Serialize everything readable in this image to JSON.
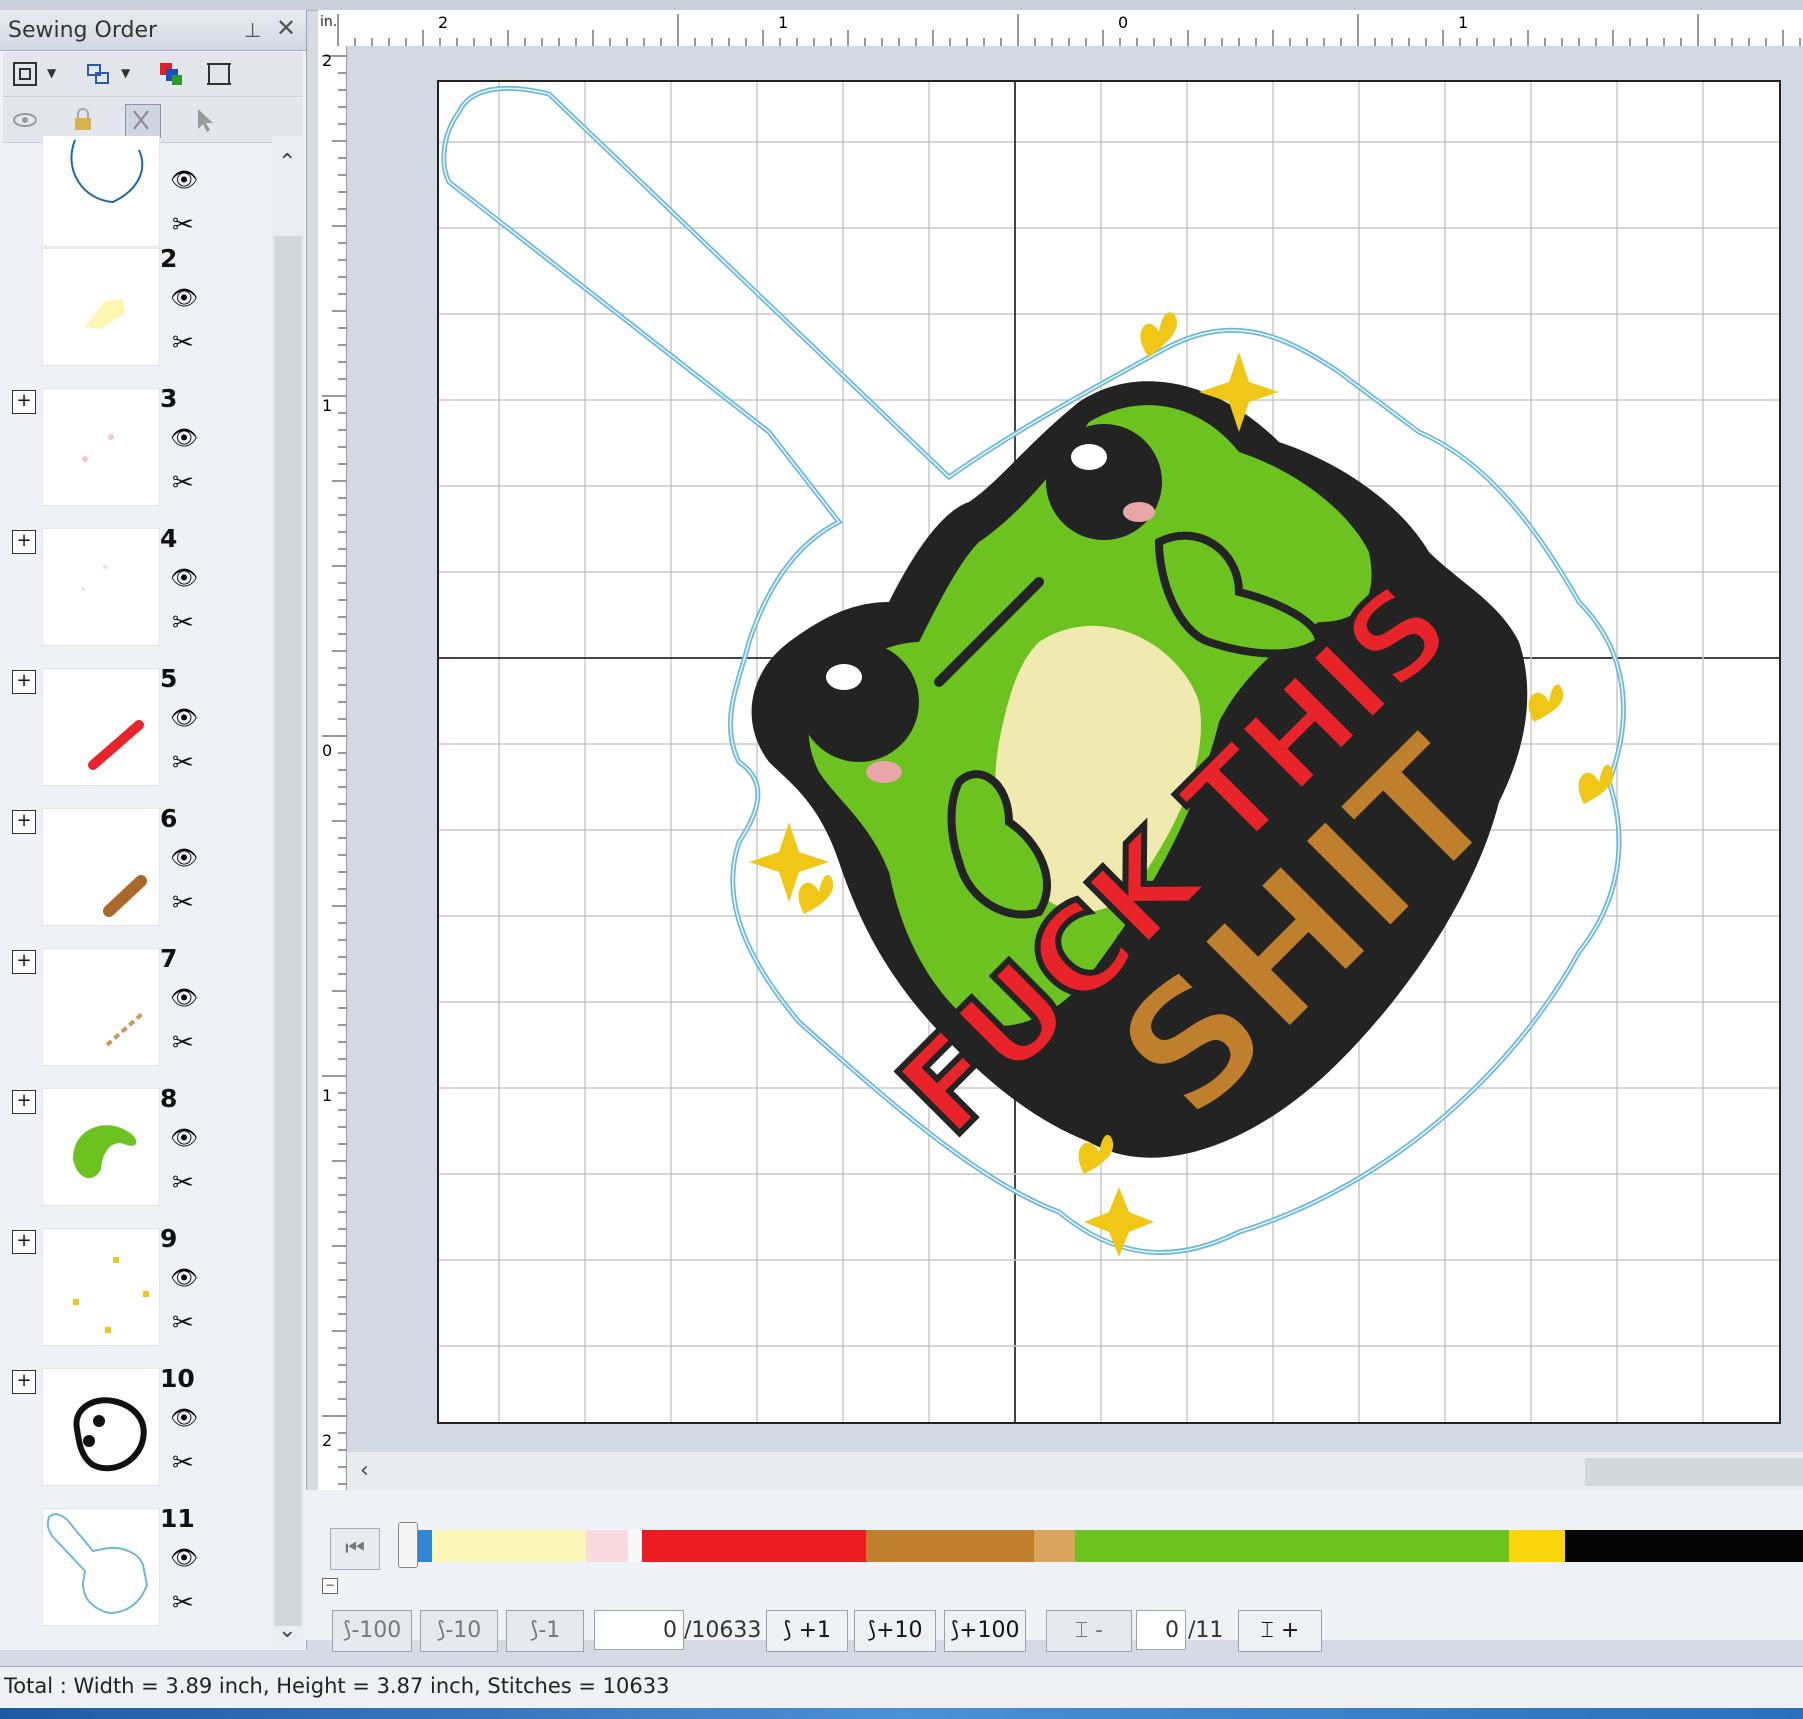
{
  "panel": {
    "title": "Sewing Order",
    "pin": "⊥",
    "close": "✕"
  },
  "sewing_items": [
    {
      "number": "",
      "has_expand": false,
      "thumb": "outline-top-icon"
    },
    {
      "number": "2",
      "has_expand": false,
      "thumb": "pale-yellow-icon"
    },
    {
      "number": "3",
      "has_expand": true,
      "thumb": "pink-dots-icon"
    },
    {
      "number": "4",
      "has_expand": true,
      "thumb": "faint-dots-icon"
    },
    {
      "number": "5",
      "has_expand": true,
      "thumb": "red-text-icon"
    },
    {
      "number": "6",
      "has_expand": true,
      "thumb": "brown-text-icon"
    },
    {
      "number": "7",
      "has_expand": true,
      "thumb": "tan-line-icon"
    },
    {
      "number": "8",
      "has_expand": true,
      "thumb": "green-frog-icon"
    },
    {
      "number": "9",
      "has_expand": true,
      "thumb": "yellow-dots-icon"
    },
    {
      "number": "10",
      "has_expand": true,
      "thumb": "black-outline-icon"
    },
    {
      "number": "11",
      "has_expand": false,
      "thumb": "blue-outline-icon"
    }
  ],
  "ruler": {
    "unit": "in.",
    "top_labels": [
      "2",
      "1",
      "0",
      "1"
    ],
    "left_labels": [
      "2",
      "1",
      "0",
      "1",
      "2"
    ]
  },
  "design_text": {
    "line1": "FUCK THIS",
    "line2": "SHIT"
  },
  "colors": {
    "frog_green": "#6cc21f",
    "belly": "#f1eab0",
    "red_text": "#e8232a",
    "brown_text": "#c07f2c",
    "yellow": "#f0c617",
    "outline_blue": "#6fb9d6",
    "black": "#232323",
    "blush": "#e9a6a9"
  },
  "color_bar": [
    {
      "color": "#2f86d6",
      "weight": 1
    },
    {
      "color": "#fbf6b9",
      "weight": 11
    },
    {
      "color": "#f9d9de",
      "weight": 3
    },
    {
      "color": "#f7f7f7",
      "weight": 1
    },
    {
      "color": "#ec1c24",
      "weight": 16
    },
    {
      "color": "#c07f2c",
      "weight": 12
    },
    {
      "color": "#d8a45e",
      "weight": 3
    },
    {
      "color": "#6cc21f",
      "weight": 31
    },
    {
      "color": "#fad50a",
      "weight": 4
    },
    {
      "color": "#050505",
      "weight": 17
    }
  ],
  "stepper": {
    "minus100": "-100",
    "minus10": "-10",
    "minus1": "-1",
    "stitch_value": "0",
    "stitch_total": "/10633",
    "plus1": "+1",
    "plus10": "+10",
    "plus100": "+100",
    "frame_minus": "-",
    "frame_value": "0",
    "frame_total": "/11",
    "frame_plus": "+"
  },
  "status": {
    "text": "Total : Width = 3.89 inch, Height = 3.87 inch, Stitches = 10633"
  }
}
